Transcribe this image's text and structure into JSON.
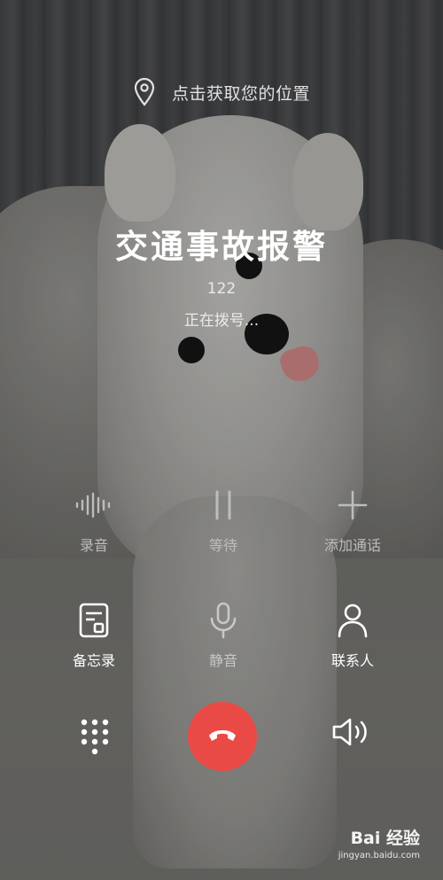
{
  "location": {
    "text": "点击获取您的位置",
    "icon": "location-pin-icon"
  },
  "caller": {
    "name": "交通事故报警",
    "number": "122",
    "status": "正在拨号..."
  },
  "controls_row1": [
    {
      "label": "录音",
      "icon": "waveform-icon"
    },
    {
      "label": "等待",
      "icon": "pause-icon"
    },
    {
      "label": "添加通话",
      "icon": "plus-icon"
    }
  ],
  "controls_row2": [
    {
      "label": "备忘录",
      "icon": "memo-icon"
    },
    {
      "label": "静音",
      "icon": "microphone-icon"
    },
    {
      "label": "联系人",
      "icon": "person-icon"
    }
  ],
  "bottom": {
    "dialpad_icon": "dialpad-icon",
    "end_call_icon": "end-call-icon",
    "speaker_icon": "speaker-icon",
    "end_call_color": "#ea4a45"
  },
  "watermark": {
    "main": "Bai 经验",
    "sub": "jingyan.baidu.com"
  }
}
